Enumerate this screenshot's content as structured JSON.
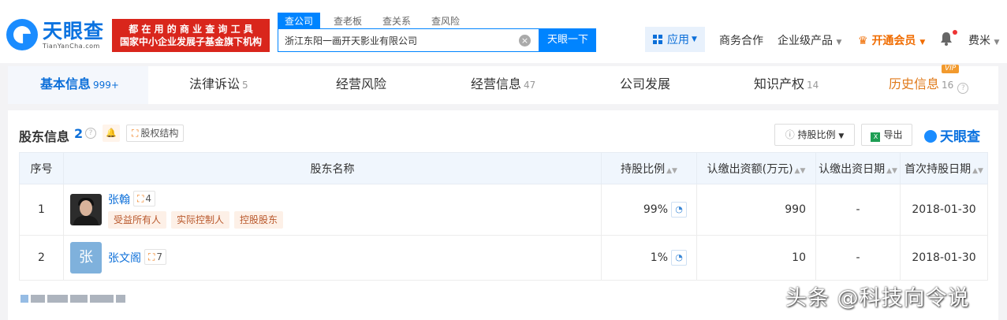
{
  "header": {
    "logo_name": "天眼查",
    "logo_url": "TianYanCha.com",
    "banner_line1": "都 在 用 的 商 业 查 询 工 具",
    "banner_line2": "国家中小企业发展子基金旗下机构",
    "search_tabs": [
      "查公司",
      "查老板",
      "查关系",
      "查风险"
    ],
    "search_value": "浙江东阳一画开天影业有限公司",
    "search_button": "天眼一下",
    "apps_label": "应用",
    "nav_items": [
      "商务合作",
      "企业级产品",
      "开通会员",
      "费米"
    ]
  },
  "tabs": [
    {
      "label": "基本信息",
      "count": "999+"
    },
    {
      "label": "法律诉讼",
      "count": "5"
    },
    {
      "label": "经营风险",
      "count": ""
    },
    {
      "label": "经营信息",
      "count": "47"
    },
    {
      "label": "公司发展",
      "count": ""
    },
    {
      "label": "知识产权",
      "count": "14"
    },
    {
      "label": "历史信息",
      "count": "16"
    }
  ],
  "vip_badge": "VIP",
  "section": {
    "title": "股东信息",
    "count": "2",
    "structure_label": "股权结构",
    "ratio_label": "持股比例",
    "export_label": "导出",
    "brand": "天眼查"
  },
  "table": {
    "headers": [
      "序号",
      "股东名称",
      "持股比例",
      "认缴出资额(万元)",
      "认缴出资日期",
      "首次持股日期"
    ],
    "rows": [
      {
        "index": "1",
        "name": "张翰",
        "relations": "4",
        "tags": [
          "受益所有人",
          "实际控制人",
          "控股股东"
        ],
        "ratio": "99%",
        "amount": "990",
        "date": "-",
        "first_date": "2018-01-30",
        "avatar": "photo"
      },
      {
        "index": "2",
        "name": "张文阁",
        "relations": "7",
        "tags": [],
        "ratio": "1%",
        "amount": "10",
        "date": "-",
        "first_date": "2018-01-30",
        "avatar": "张"
      }
    ]
  },
  "watermark": "头条 @科技向令说",
  "colors": {
    "brand_blue": "#0084ff",
    "link_blue": "#0c6fd9",
    "banner_red": "#d9261c",
    "vip_orange": "#f06c00"
  },
  "icons": [
    "search-clear-icon",
    "apps-grid-icon",
    "crown-icon",
    "bell-icon",
    "help-icon",
    "alert-bell-icon",
    "structure-icon",
    "excel-icon",
    "pie-chart-icon",
    "relation-icon"
  ]
}
